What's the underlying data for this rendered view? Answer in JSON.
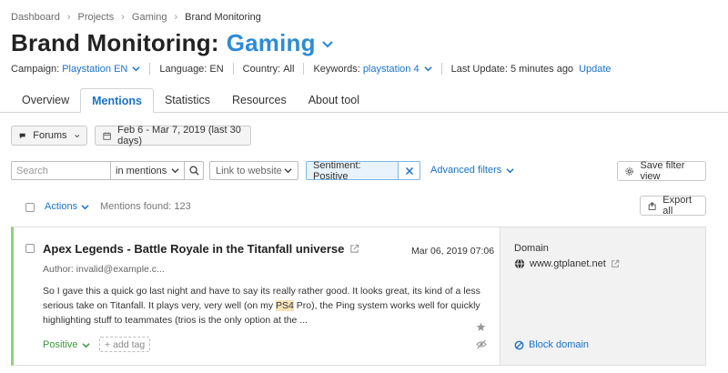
{
  "breadcrumb": [
    "Dashboard",
    "Projects",
    "Gaming",
    "Brand Monitoring"
  ],
  "title": {
    "main": "Brand Monitoring:",
    "project": "Gaming"
  },
  "info": {
    "campaign_label": "Campaign:",
    "campaign_value": "Playstation EN",
    "language_label": "Language:",
    "language_value": "EN",
    "country_label": "Country:",
    "country_value": "All",
    "keywords_label": "Keywords:",
    "keywords_value": "playstation 4",
    "update_label": "Last Update:",
    "update_value": "5 minutes ago",
    "update_link": "Update"
  },
  "tabs": [
    "Overview",
    "Mentions",
    "Statistics",
    "Resources",
    "About tool"
  ],
  "active_tab": "Mentions",
  "filters": {
    "source": "Forums",
    "date_range": "Feb 6 - Mar 7, 2019 (last 30 days)",
    "search_placeholder": "Search",
    "search_scope": "in mentions",
    "link_placeholder": "Link to website",
    "sentiment": "Sentiment: Positive",
    "advanced": "Advanced filters",
    "save_view": "Save filter view"
  },
  "list": {
    "actions": "Actions",
    "found": "Mentions found: 123",
    "export": "Export all"
  },
  "mention": {
    "title": "Apex Legends - Battle Royale in the Titanfall universe",
    "date": "Mar 06, 2019 07:06",
    "author": "Author: invalid@example.c...",
    "text_before": "So I gave this a quick go last night and have to say its really rather good. It looks great, its kind of a less serious take on Titanfall. It plays very, very well (on my ",
    "text_highlight": "PS4",
    "text_after": " Pro), the Ping system works well for quickly highlighting stuff to teammates (trios is the only option at the ...",
    "sentiment": "Positive",
    "add_tag": "add tag",
    "domain_label": "Domain",
    "domain": "www.gtplanet.net",
    "block": "Block domain"
  },
  "colors": {
    "accent": "#1a73c9",
    "title_accent": "#2d8bd6",
    "positive": "#3a9a3a",
    "card_border": "#8fd27a"
  }
}
